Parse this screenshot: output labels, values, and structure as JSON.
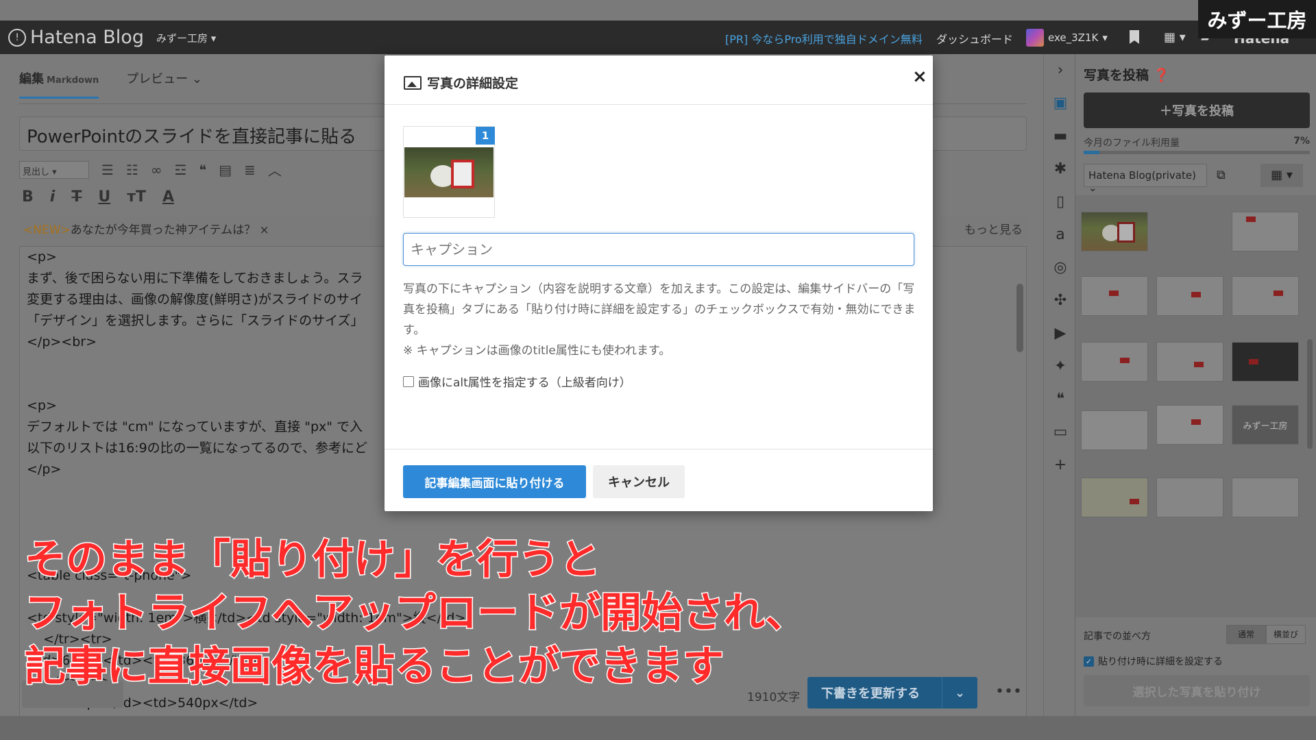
{
  "topbar": {
    "logo": "Hatena Blog",
    "blog_selector": "みずー工房",
    "promo": "[PR] 今ならPro利用で独自ドメイン無料",
    "dashboard": "ダッシュボード",
    "username": "exe_3Z1K",
    "hatena_right": "Hatena"
  },
  "watermark": "みずー工房",
  "editor": {
    "tab_edit": "編集",
    "tab_edit_mode": "Markdown",
    "tab_preview": "プレビュー",
    "title": "PowerPointのスライドを直接記事に貼る",
    "heading_select": "見出し",
    "notice_new": "<NEW>",
    "notice_text": "あなたが今年買った神アイテムは？",
    "notice_more": "もっと見る",
    "code_lines": [
      "<p>",
      "まず、後で困らない用に下準備をしておきましょう。スラ",
      "変更する理由は、画像の解像度(鮮明さ)がスライドのサイ",
      "「デザイン」を選択します。さらに「スライドのサイズ」",
      "</p><br>",
      "",
      "",
      "<p>",
      "デフォルトでは \"cm\" になっていますが、直接 \"px\" で入",
      "以下のリストは16:9の比の一覧になってるので、参考にど",
      "</p>",
      "",
      "",
      "",
      "",
      "<table class=\"t-phone\">",
      "",
      "<td style=\"width: 1em\">横</td><td style=\"width: 1em\">縦</td>",
      "    </tr><tr>",
      "<td>640px</td><td>360px</td>",
      "    </tr><tr>",
      "<td>960px</td><td>540px</td>"
    ],
    "char_count": "1910文字",
    "update_button": "下書きを更新する"
  },
  "sidebar": {
    "header": "写真を投稿",
    "post_button": "＋写真を投稿",
    "usage_label": "今月のファイル利用量",
    "usage_pct": "7%",
    "usage_value": 0.07,
    "account": "Hatena Blog(private)",
    "thumb_label": "みずー工房",
    "sort_label": "記事での並べ方",
    "sort_normal": "通常",
    "sort_side": "横並び",
    "detail_checkbox": "貼り付け時に詳細を設定する",
    "paste_selected": "選択した写真を貼り付け"
  },
  "modal": {
    "title": "写真の詳細設定",
    "image_number": "1",
    "caption_placeholder": "キャプション",
    "description": "写真の下にキャプション（内容を説明する文章）を加えます。この設定は、編集サイドバーの「写真を投稿」タブにある「貼り付け時に詳細を設定する」のチェックボックスで有効・無効にできます。",
    "note": "※ キャプションは画像のtitle属性にも使われます。",
    "alt_checkbox": "画像にalt属性を指定する（上級者向け）",
    "paste_button": "記事編集画面に貼り付ける",
    "cancel_button": "キャンセル"
  },
  "subtitle": {
    "line1": "そのまま「貼り付け」を行うと",
    "line2": "フォトライフへアップロードが開始され、",
    "line3": "記事に直接画像を貼ることができます"
  }
}
